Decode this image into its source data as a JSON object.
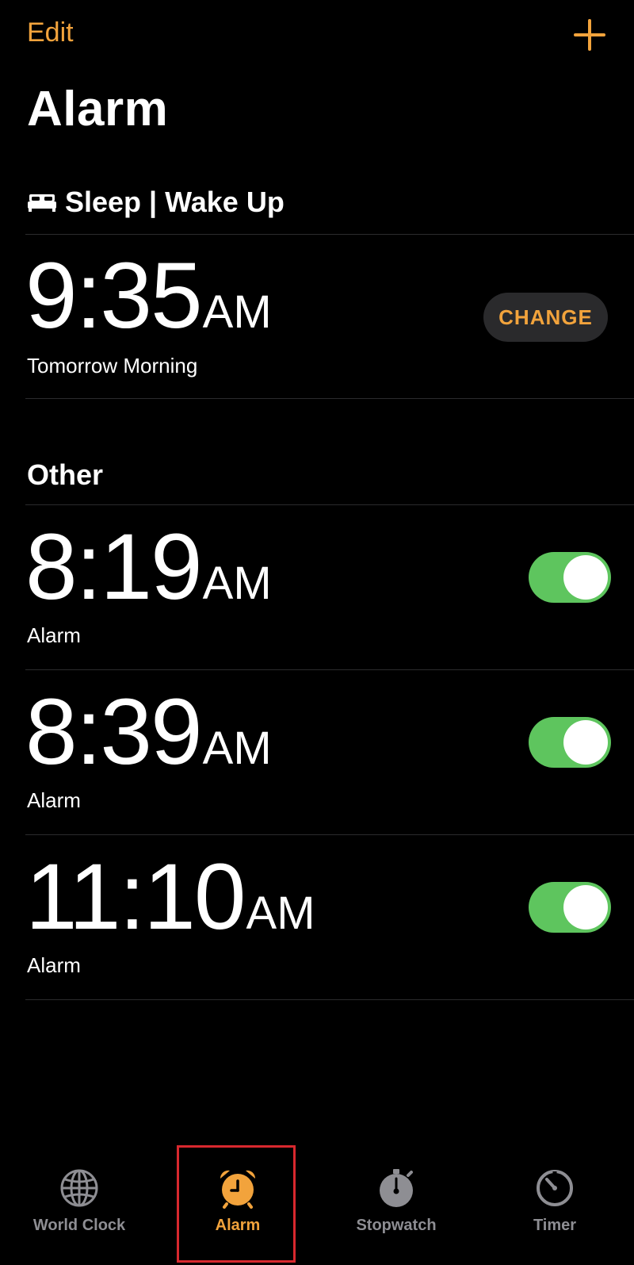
{
  "header": {
    "edit_label": "Edit",
    "title": "Alarm"
  },
  "sleep": {
    "section_title": "Sleep | Wake Up",
    "time": "9:35",
    "ampm": "AM",
    "subtitle": "Tomorrow Morning",
    "change_label": "CHANGE"
  },
  "other": {
    "section_title": "Other",
    "alarms": [
      {
        "time": "8:19",
        "ampm": "AM",
        "label": "Alarm",
        "enabled": true
      },
      {
        "time": "8:39",
        "ampm": "AM",
        "label": "Alarm",
        "enabled": true
      },
      {
        "time": "11:10",
        "ampm": "AM",
        "label": "Alarm",
        "enabled": true
      }
    ]
  },
  "tabs": [
    {
      "label": "World Clock",
      "icon": "globe-icon",
      "active": false
    },
    {
      "label": "Alarm",
      "icon": "alarm-clock-icon",
      "active": true
    },
    {
      "label": "Stopwatch",
      "icon": "stopwatch-icon",
      "active": false
    },
    {
      "label": "Timer",
      "icon": "timer-icon",
      "active": false
    }
  ],
  "colors": {
    "accent": "#f2a33c",
    "toggle_on": "#5ec55e",
    "inactive_tab": "#8e8e93",
    "highlight": "#d8282e"
  }
}
